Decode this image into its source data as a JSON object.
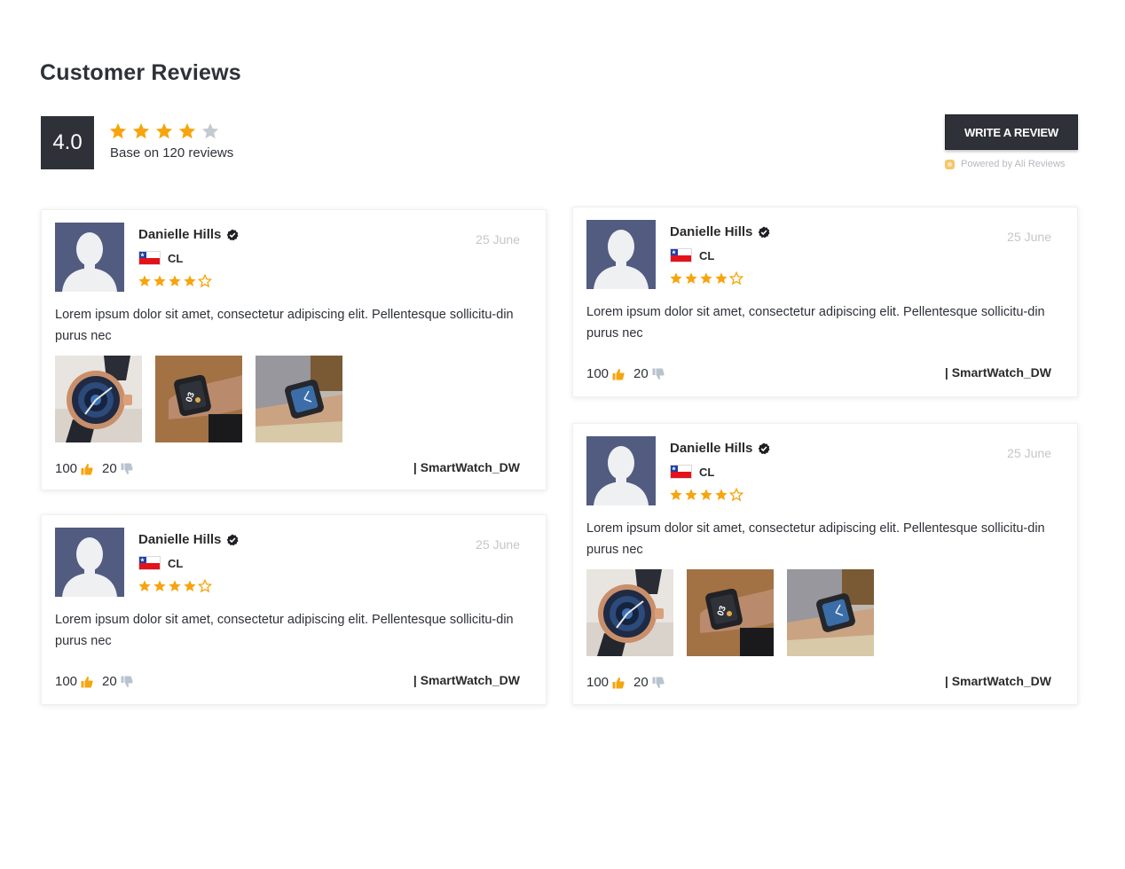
{
  "page": {
    "title": "Customer Reviews",
    "score": "4.0",
    "stars_filled": 4,
    "stars_total": 5,
    "summary": "Base on 120 reviews",
    "write_review_label": "WRITE A REVIEW",
    "powered_by": "Powered by Ali Reviews"
  },
  "colors": {
    "dark": "#2e3138",
    "star": "#f6a50f",
    "star_empty": "#c5c9d0",
    "avatar_bg": "#525b80",
    "date": "#c4c6c9"
  },
  "reviews": [
    {
      "name": "Danielle Hills",
      "country": "CL",
      "rating": 4,
      "date": "25 June",
      "body": "Lorem ipsum dolor sit amet, consectetur adipiscing elit. Pellentesque sollicitu-din purus nec",
      "photos": [
        "watch-photo-1",
        "watch-photo-2",
        "watch-photo-3"
      ],
      "likes": "100",
      "dislikes": "20",
      "product": "| SmartWatch_DW"
    },
    {
      "name": "Danielle Hills",
      "country": "CL",
      "rating": 4,
      "date": "25 June",
      "body": "Lorem ipsum dolor sit amet, consectetur adipiscing elit. Pellentesque sollicitu-din purus nec",
      "photos": [],
      "likes": "100",
      "dislikes": "20",
      "product": "| SmartWatch_DW"
    },
    {
      "name": "Danielle Hills",
      "country": "CL",
      "rating": 4,
      "date": "25 June",
      "body": "Lorem ipsum dolor sit amet, consectetur adipiscing elit. Pellentesque sollicitu-din purus nec",
      "photos": [],
      "likes": "100",
      "dislikes": "20",
      "product": "| SmartWatch_DW"
    },
    {
      "name": "Danielle Hills",
      "country": "CL",
      "rating": 4,
      "date": "25 June",
      "body": "Lorem ipsum dolor sit amet, consectetur adipiscing elit. Pellentesque sollicitu-din purus nec",
      "photos": [
        "watch-photo-1",
        "watch-photo-2",
        "watch-photo-3"
      ],
      "likes": "100",
      "dislikes": "20",
      "product": "| SmartWatch_DW"
    }
  ]
}
